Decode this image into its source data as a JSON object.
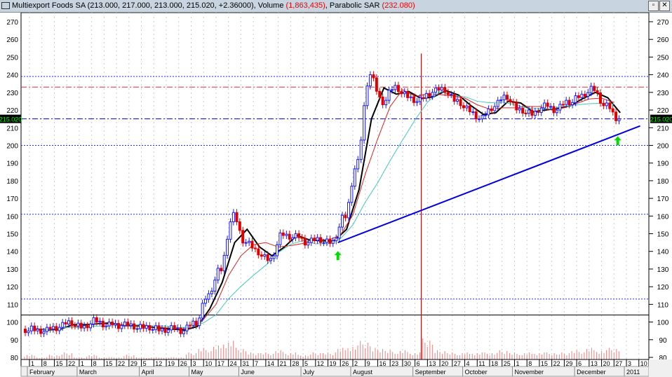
{
  "title": {
    "symbol": "Multiexport Foods SA",
    "ohlc": "(213.000, 217.000, 213.000, 215.020, +2.36000)",
    "volume_label": "Volume",
    "volume_value": "(1,863,435)",
    "sar_label": "Parabolic SAR",
    "sar_value": "(232.080)"
  },
  "window_buttons": {
    "restore": "▫",
    "close": "✕"
  },
  "chart_data": {
    "type": "candlestick",
    "title": "Multiexport Foods SA",
    "ylim": [
      80,
      275
    ],
    "y_ticks": [
      80,
      90,
      100,
      110,
      120,
      130,
      140,
      150,
      160,
      170,
      180,
      190,
      200,
      210,
      220,
      230,
      240,
      250,
      260,
      270
    ],
    "last_price_label": "215.020",
    "x_week_labels": [
      "1",
      "8",
      "15",
      "22",
      "1",
      "8",
      "15",
      "22",
      "29",
      "5",
      "12",
      "19",
      "26",
      "3",
      "10",
      "17",
      "24",
      "31",
      "7",
      "14",
      "21",
      "28",
      "5",
      "12",
      "19",
      "26",
      "2",
      "9",
      "16",
      "23",
      "30",
      "6",
      "13",
      "20",
      "27",
      "4",
      "11",
      "18",
      "25",
      "1",
      "8",
      "15",
      "22",
      "29",
      "6",
      "13",
      "20",
      "27",
      "3",
      "10"
    ],
    "months": [
      {
        "label": "February",
        "week": 0
      },
      {
        "label": "March",
        "week": 4
      },
      {
        "label": "April",
        "week": 9
      },
      {
        "label": "May",
        "week": 13
      },
      {
        "label": "June",
        "week": 17
      },
      {
        "label": "July",
        "week": 22
      },
      {
        "label": "August",
        "week": 26
      },
      {
        "label": "September",
        "week": 31
      },
      {
        "label": "October",
        "week": 35
      },
      {
        "label": "November",
        "week": 39
      },
      {
        "label": "December",
        "week": 44
      },
      {
        "label": "2011",
        "week": 48
      }
    ],
    "weekly_close": [
      96,
      95,
      97,
      100,
      97,
      101,
      98,
      98,
      98,
      97,
      96,
      96,
      95,
      100,
      115,
      130,
      160,
      145,
      140,
      135,
      150,
      148,
      145,
      147,
      145,
      160,
      190,
      240,
      225,
      233,
      228,
      225,
      230,
      232,
      225,
      220,
      215,
      222,
      228,
      220,
      218,
      222,
      220,
      225,
      228,
      232,
      222,
      215
    ],
    "weekly_volume": [
      2,
      1,
      2,
      3,
      1,
      2,
      1,
      1,
      2,
      1,
      1,
      1,
      1,
      3,
      5,
      6,
      8,
      5,
      3,
      3,
      4,
      3,
      2,
      3,
      3,
      5,
      6,
      8,
      5,
      4,
      4,
      3,
      9,
      4,
      3,
      3,
      3,
      3,
      4,
      3,
      3,
      3,
      3,
      3,
      4,
      5,
      4,
      5
    ],
    "horizontal_lines": [
      {
        "price": 239,
        "style": "blue-dotted"
      },
      {
        "price": 233,
        "style": "red-dashdot"
      },
      {
        "price": 215,
        "style": "blue-dashdot"
      },
      {
        "price": 200,
        "style": "blue-dotted"
      },
      {
        "price": 161,
        "style": "blue-dotted"
      },
      {
        "price": 113,
        "style": "blue-dotted"
      },
      {
        "price": 104,
        "style": "black-solid"
      }
    ],
    "trendline": {
      "from": {
        "week": 24.8,
        "price": 145
      },
      "to": {
        "week": 49.1,
        "price": 211
      }
    },
    "signal_arrows": [
      {
        "week": 24.8,
        "price": 137
      },
      {
        "week": 47.3,
        "price": 202
      }
    ],
    "vertical_marker_week": 31.5,
    "colors": {
      "up": "#1a1aff",
      "down": "#e00000",
      "ma_fast": "#000000",
      "ma_mid": "#e02020",
      "ma_slow": "#40c8c0",
      "trend": "#0000e0",
      "arrow": "#00dd00"
    }
  }
}
